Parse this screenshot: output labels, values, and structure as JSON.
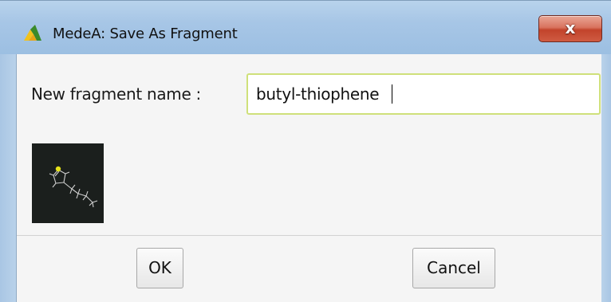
{
  "window": {
    "title": "MedeA: Save As Fragment",
    "close_label": "x",
    "accent_color": "#cfe07a"
  },
  "form": {
    "name_label": "New fragment name :",
    "name_value": "butyl-thiophene"
  },
  "preview": {
    "icon": "molecule-structure-preview"
  },
  "buttons": {
    "ok_label": "OK",
    "cancel_label": "Cancel"
  }
}
